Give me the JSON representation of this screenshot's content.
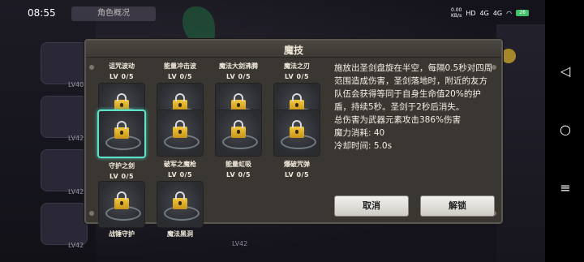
{
  "status": {
    "time": "08:55",
    "net": "0.00\nKB/s",
    "hd": "HD",
    "g1": "4G",
    "g2": "4G",
    "battery": "26"
  },
  "header": {
    "top_button_label": "角色概况"
  },
  "sidebar": {
    "levels": [
      "LV40",
      "LV42",
      "LV42",
      "LV42"
    ],
    "bottom_level": "LV42"
  },
  "modal": {
    "title": "魔技",
    "skills": [
      {
        "name": "诅咒波动",
        "level": "LV 0/5",
        "selected": false
      },
      {
        "name": "能量冲击波",
        "level": "LV 0/5",
        "selected": false
      },
      {
        "name": "魔法大剑沸腾",
        "level": "LV 0/5",
        "selected": false
      },
      {
        "name": "魔法之刃",
        "level": "LV 0/5",
        "selected": false
      },
      {
        "name": "守护之剑",
        "level": "LV 0/5",
        "selected": true
      },
      {
        "name": "破军之魔枪",
        "level": "LV 0/5",
        "selected": false
      },
      {
        "name": "能量虹吸",
        "level": "LV 0/5",
        "selected": false
      },
      {
        "name": "爆破咒弹",
        "level": "LV 0/5",
        "selected": false
      },
      {
        "name": "战锤守护",
        "level": "LV 0/5",
        "selected": false
      },
      {
        "name": "魔法黑洞",
        "level": "LV 0/5",
        "selected": false
      }
    ],
    "description": "施放出圣剑盘旋在半空，每隔0.5秒对四周范围造成伤害，圣剑落地时，附近的友方队伍会获得等同于自身生命值20%的护盾，持续5秒。圣剑于2秒后消失。",
    "damage_line": "总伤害为武器元素攻击386%伤害",
    "mana_cost": "魔力消耗: 40",
    "cooldown": "冷却时间: 5.0s",
    "cancel_label": "取消",
    "unlock_label": "解锁"
  }
}
